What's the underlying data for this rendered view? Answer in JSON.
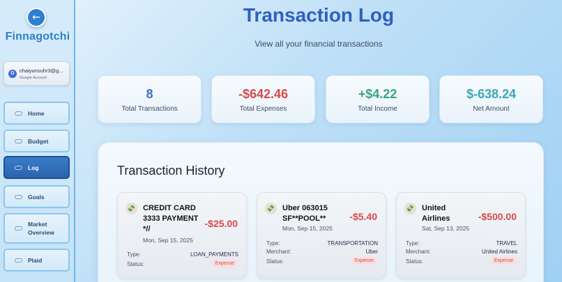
{
  "sidebar": {
    "back_icon": "arrow-left-icon",
    "brand": "Finnagotchi",
    "account": {
      "email": "chaiyunsuhr3@g...",
      "label": "Google Account",
      "icon": "G"
    },
    "items": [
      {
        "label": "Home"
      },
      {
        "label": "Budget"
      },
      {
        "label": "Log"
      },
      {
        "label": "Goals"
      },
      {
        "label": "Market Overview"
      },
      {
        "label": "Plaid"
      }
    ]
  },
  "header": {
    "title": "Transaction Log",
    "subtitle": "View all your financial transactions"
  },
  "stats": [
    {
      "value": "8",
      "label": "Total Transactions",
      "color": "#3f6fc8"
    },
    {
      "value": "-$642.46",
      "label": "Total Expenses",
      "color": "#d84a4a"
    },
    {
      "value": "+$4.22",
      "label": "Total Income",
      "color": "#3aa37a"
    },
    {
      "value": "$-638.24",
      "label": "Net Amount",
      "color": "#3aa7b8"
    }
  ],
  "history": {
    "title": "Transaction History",
    "transactions": [
      {
        "name": "CREDIT CARD 3333 PAYMENT *//",
        "date": "Mon, Sep 15, 2025",
        "amount": "-$25.00",
        "type_label": "Type:",
        "type": "LOAN_PAYMENTS",
        "status_label": "Status:",
        "status": "Expense"
      },
      {
        "name": "Uber 063015 SF**POOL**",
        "date": "Mon, Sep 15, 2025",
        "amount": "-$5.40",
        "type_label": "Type:",
        "type": "TRANSPORTATION",
        "merchant_label": "Merchant:",
        "merchant": "Uber",
        "status_label": "Status:",
        "status": "Expense"
      },
      {
        "name": "United Airlines",
        "date": "Sat, Sep 13, 2025",
        "amount": "-$500.00",
        "type_label": "Type:",
        "type": "TRAVEL",
        "merchant_label": "Merchant:",
        "merchant": "United Airlines",
        "status_label": "Status:",
        "status": "Expense"
      }
    ]
  }
}
